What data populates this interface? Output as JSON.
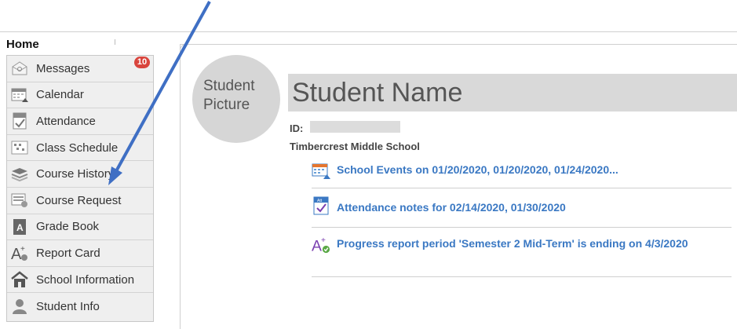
{
  "sidebar": {
    "title": "Home",
    "items": [
      {
        "label": "Messages",
        "icon": "envelope-icon",
        "badge": "10"
      },
      {
        "label": "Calendar",
        "icon": "calendar-icon"
      },
      {
        "label": "Attendance",
        "icon": "attendance-icon"
      },
      {
        "label": "Class Schedule",
        "icon": "class-schedule-icon"
      },
      {
        "label": "Course History",
        "icon": "course-history-icon"
      },
      {
        "label": "Course Request",
        "icon": "course-request-icon"
      },
      {
        "label": "Grade Book",
        "icon": "grade-book-icon"
      },
      {
        "label": "Report Card",
        "icon": "report-card-icon"
      },
      {
        "label": "School Information",
        "icon": "school-icon"
      },
      {
        "label": "Student Info",
        "icon": "student-info-icon"
      }
    ]
  },
  "student": {
    "picture_label": "Student\nPicture",
    "name": "Student Name",
    "id_label": "ID:",
    "school": "Timbercrest Middle School"
  },
  "notices": [
    {
      "text": "School Events on 01/20/2020, 01/20/2020, 01/24/2020...",
      "icon": "calendar-icon"
    },
    {
      "text": "Attendance notes for 02/14/2020, 01/30/2020",
      "icon": "attendance-icon"
    },
    {
      "text": "Progress report period 'Semester 2 Mid-Term' is ending on 4/3/2020",
      "icon": "report-card-icon"
    }
  ],
  "colors": {
    "link": "#3a78c3",
    "badge": "#d9453d",
    "annotation_arrow": "#3f6fc4"
  }
}
